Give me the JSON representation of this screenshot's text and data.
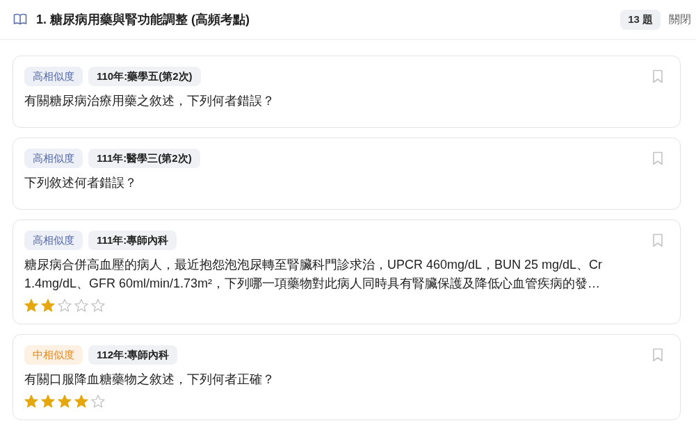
{
  "header": {
    "title": "1. 糖尿病用藥與腎功能調整 (高頻考點)",
    "count": "13 題",
    "close": "關閉"
  },
  "questions": [
    {
      "similarity": {
        "kind": "high",
        "label": "高相似度"
      },
      "source": "110年:藥學五(第2次)",
      "text": "有關糖尿病治療用藥之敘述，下列何者錯誤？",
      "bookmarked": false
    },
    {
      "similarity": {
        "kind": "high",
        "label": "高相似度"
      },
      "source": "111年:醫學三(第2次)",
      "text": "下列敘述何者錯誤？",
      "bookmarked": false
    },
    {
      "similarity": {
        "kind": "high",
        "label": "高相似度"
      },
      "source": "111年:專師內科",
      "text": "糖尿病合併高血壓的病人，最近抱怨泡泡尿轉至腎臟科門診求治，UPCR 460mg/dL，BUN 25 mg/dL、Cr 1.4mg/dL、GFR 60ml/min/1.73m²，下列哪一項藥物對此病人同時具有腎臟保護及降低心血管疾病的發…",
      "bookmarked": false,
      "stars": 2
    },
    {
      "similarity": {
        "kind": "medium",
        "label": "中相似度"
      },
      "source": "112年:專師內科",
      "text": "有關口服降血糖藥物之敘述，下列何者正確？",
      "bookmarked": false,
      "stars": 4
    }
  ]
}
